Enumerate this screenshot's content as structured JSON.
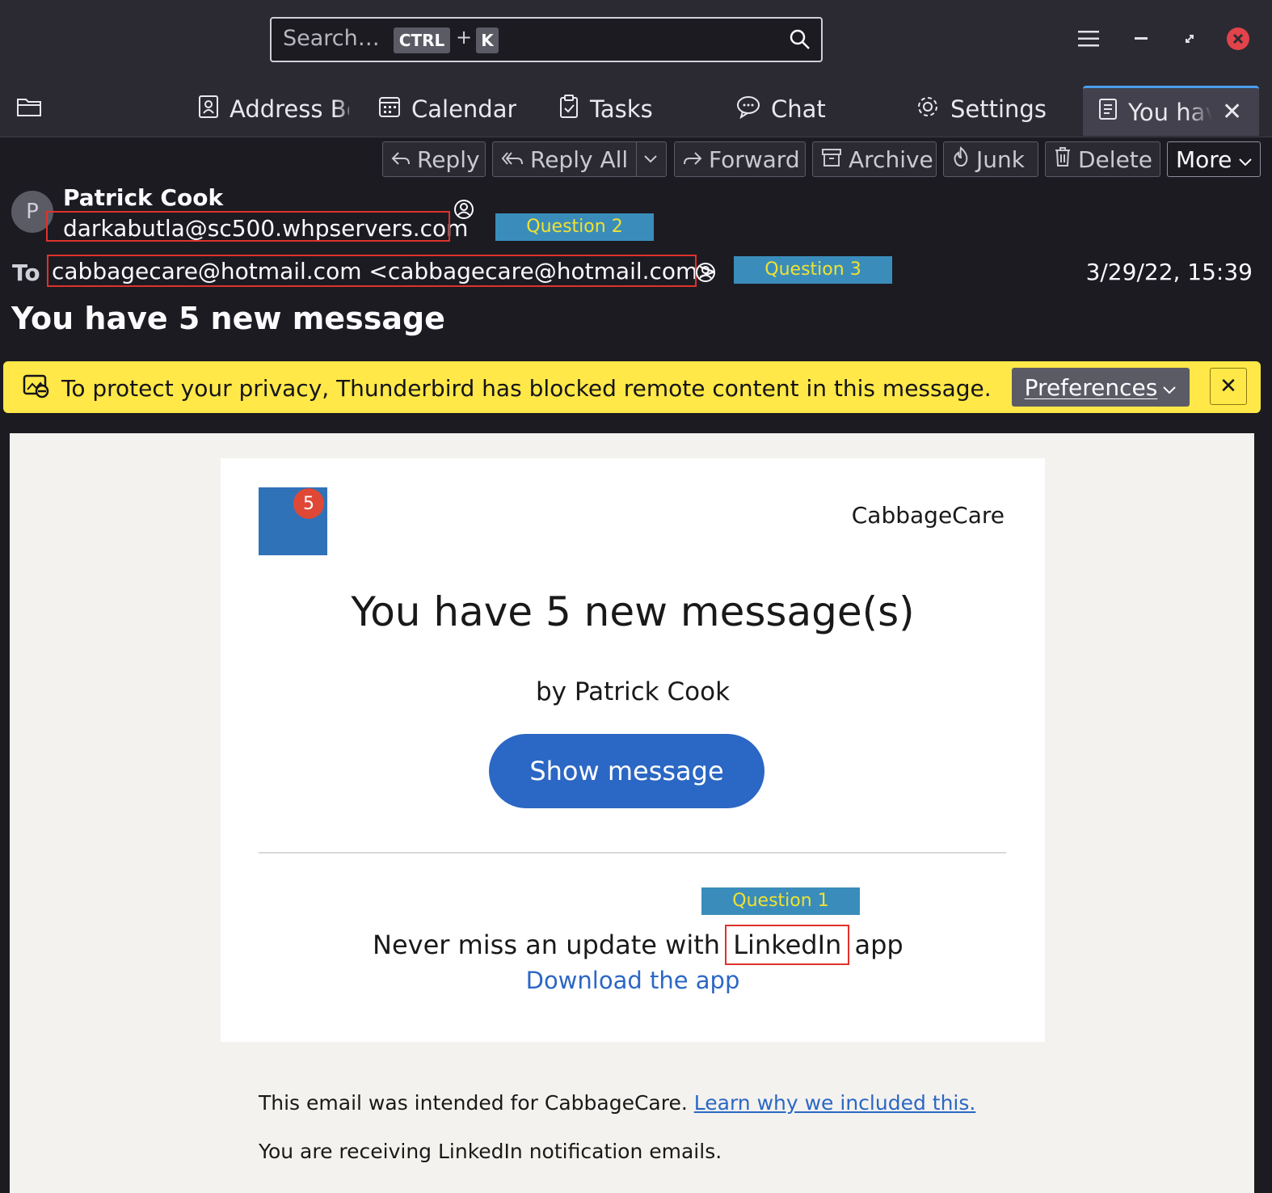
{
  "search": {
    "placeholder": "Search…",
    "key1": "CTRL",
    "plus": "+",
    "key2": "K"
  },
  "tabs": [
    {
      "label": "Address Bo"
    },
    {
      "label": "Calendar"
    },
    {
      "label": "Tasks"
    },
    {
      "label": "Chat"
    },
    {
      "label": "Settings"
    },
    {
      "label": "You hav"
    }
  ],
  "toolbar": {
    "reply": "Reply",
    "reply_all": "Reply All",
    "forward": "Forward",
    "archive": "Archive",
    "junk": "Junk",
    "delete": "Delete",
    "more": "More"
  },
  "message": {
    "avatar_letter": "P",
    "sender_name": "Patrick Cook",
    "sender_email": "darkabutla@sc500.whpservers.com",
    "to_label": "To",
    "to_value": "cabbagecare@hotmail.com <cabbagecare@hotmail.com>",
    "date": "3/29/22, 15:39",
    "subject": "You have 5 new message"
  },
  "annotations": {
    "q1": "Question 1",
    "q2": "Question 2",
    "q3": "Question 3"
  },
  "notification": {
    "text": "To protect your privacy, Thunderbird has blocked remote content in this message.",
    "preferences": "Preferences"
  },
  "email": {
    "badge": "5",
    "brand": "CabbageCare",
    "headline": "You have 5 new message(s)",
    "byline": "by Patrick Cook",
    "button": "Show message",
    "never_prefix": "Never miss an update with",
    "never_brand": "LinkedIn",
    "never_suffix": "app",
    "download": "Download the app",
    "footer1_text": "This email was intended for CabbageCare.",
    "footer1_link": "Learn why we included this.",
    "footer2": "You are receiving LinkedIn notification emails."
  },
  "colors": {
    "accent": "#2b67c4",
    "notification": "#ffe847",
    "annotation_box": "#e0322b",
    "annotation_label": "#3a8dbb"
  }
}
